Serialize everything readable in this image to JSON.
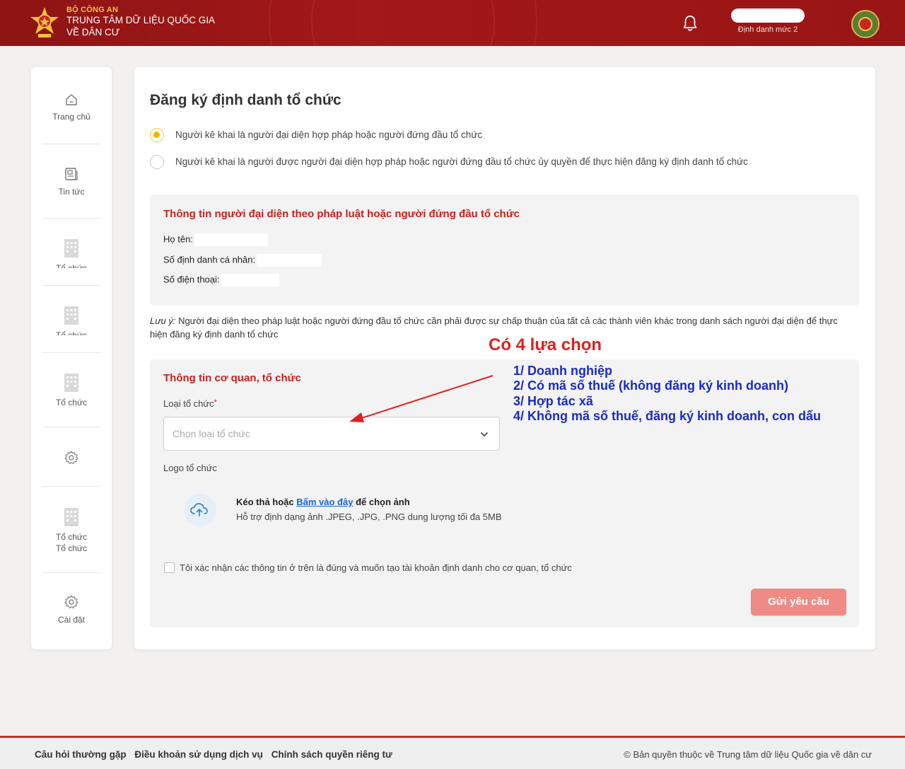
{
  "header": {
    "ministry": "BỘ CÔNG AN",
    "org_line1": "TRUNG TÂM DỮ LIỆU QUỐC GIA",
    "org_line2": "VỀ DÂN CƯ",
    "user_level": "Định danh mức 2",
    "brand_color": "#9a1515"
  },
  "sidebar": {
    "items": [
      {
        "label": "Trang chủ",
        "icon": "home-icon"
      },
      {
        "label": "Tin tức",
        "icon": "news-icon"
      },
      {
        "label": "Tổ chức",
        "icon": "building-icon"
      },
      {
        "label": "Tổ chức",
        "icon": "building-icon"
      },
      {
        "label": "Tổ chức",
        "icon": "building-icon"
      },
      {
        "label": "",
        "icon": "gear-icon"
      },
      {
        "label": "Tổ chức",
        "label2": "Tổ chức",
        "icon": "building-icon"
      },
      {
        "label": "Cài đặt",
        "icon": "gear-icon"
      }
    ]
  },
  "main": {
    "title": "Đăng ký định danh tổ chức",
    "radio_options": [
      {
        "label": "Người kê khai là người đại diện hợp pháp hoặc người đứng đầu tổ chức",
        "checked": true
      },
      {
        "label": "Người kê khai là người được người đại diện hợp pháp hoặc người đứng đầu tổ chức ủy quyền để thực hiện đăng ký định danh tổ chức",
        "checked": false
      }
    ],
    "representative": {
      "title": "Thông tin người đại diện theo pháp luật hoặc người đứng đầu tổ chức",
      "name_label": "Họ tên:",
      "id_label": "Số định danh cá nhân:",
      "phone_label": "Số điện thoại:"
    },
    "note_label": "Lưu ý:",
    "note_text": "Người đại diện theo pháp luật hoặc người đứng đầu tổ chức cần phải được sự chấp thuận của tất cả các thành viên khác trong danh sách người đại diện để thực hiện đăng ký định danh tổ chức",
    "organization": {
      "title": "Thông tin cơ quan, tổ chức",
      "type_label": "Loại tổ chức",
      "type_required": "*",
      "type_placeholder": "Chọn loại tổ chức",
      "logo_label": "Logo tổ chức",
      "upload_prefix": "Kéo thả hoặc",
      "upload_link": "Bấm vào đây",
      "upload_suffix": "để chọn ảnh",
      "upload_hint": "Hỗ trợ định dạng ảnh .JPEG, .JPG, .PNG dung lượng tối đa 5MB"
    },
    "confirm_label": "Tôi xác nhận các thông tin ở trên là đúng và muốn tạo tài khoản định danh cho cơ quan, tổ chức",
    "submit_label": "Gửi yêu cầu"
  },
  "annotation": {
    "title": "Có 4 lựa chọn",
    "items": [
      "1/ Doanh nghiệp",
      "2/ Có mã số thuế (không đăng ký kinh doanh)",
      "3/ Hợp tác xã",
      "4/ Không mã số thuế, đăng ký kinh doanh, con dấu"
    ],
    "title_color": "#e02020",
    "items_color": "#1a2bc4"
  },
  "footer": {
    "links": [
      "Câu hỏi thường gặp",
      "Điều khoản sử dụng dịch vụ",
      "Chính sách quyền riêng tư"
    ],
    "copyright": "© Bản quyền thuộc về Trung tâm dữ liệu Quốc gia về dân cư"
  }
}
